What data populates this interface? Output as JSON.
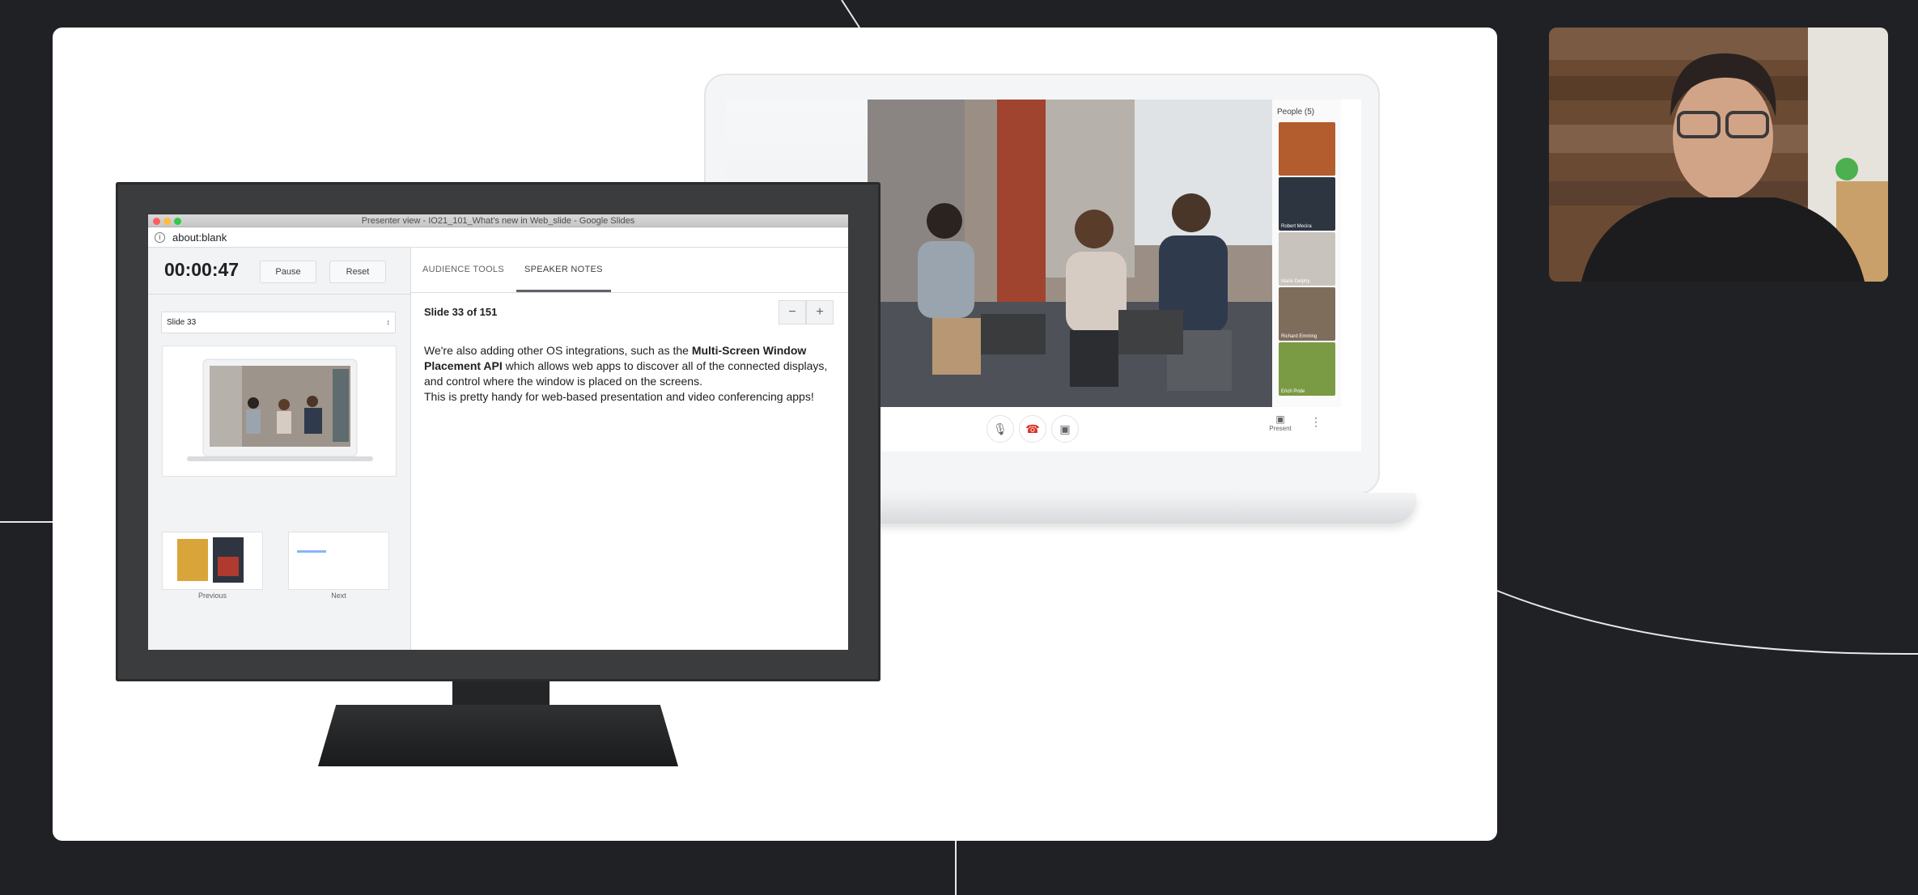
{
  "presenter_window": {
    "title": "Presenter view - IO21_101_What's new in Web_slide - Google Slides",
    "url": "about:blank",
    "timer": "00:00:47",
    "pause_label": "Pause",
    "reset_label": "Reset",
    "slide_select": "Slide 33",
    "previous_label": "Previous",
    "next_label": "Next",
    "tabs": [
      "AUDIENCE TOOLS",
      "SPEAKER NOTES"
    ],
    "active_tab": "SPEAKER NOTES",
    "slide_count": "Slide 33 of 151",
    "zoom_out": "−",
    "zoom_in": "+",
    "notes": {
      "part1": "We're also adding other OS integrations, such as the ",
      "bold": "Multi-Screen Window Placement API",
      "part2": " which allows web apps to discover all of the connected displays, and control where the window is placed on the screens.",
      "line2": "This is pretty handy for web-based presentation and video conferencing apps!"
    }
  },
  "meet": {
    "people_title": "People (5)",
    "present_label": "Present",
    "participants": [
      "",
      "Robert Mecira",
      "Marie Delphy",
      "Richard Emming",
      "Erich Pride"
    ]
  },
  "colors": {
    "background": "#202124",
    "card": "#ffffff",
    "monitor_bezel": "#3a3c3e",
    "hangup": "#d93025"
  }
}
